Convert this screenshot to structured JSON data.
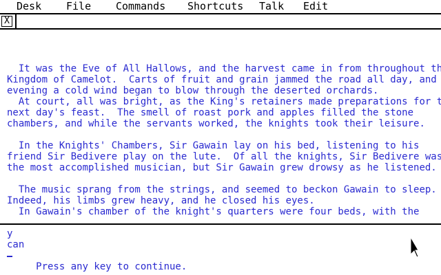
{
  "menubar": {
    "items": [
      "Desk",
      "File",
      "Commands",
      "Shortcuts",
      "Talk",
      "Edit"
    ]
  },
  "window": {
    "close_glyph": "X"
  },
  "story": {
    "lines": [
      "  It was the Eve of All Hallows, and the harvest came in from throughout the",
      "Kingdom of Camelot.  Carts of fruit and grain jammed the road all day, and by",
      "evening a cold wind began to blow through the deserted orchards.",
      "  At court, all was bright, as the King's retainers made preparations for the",
      "next day's feast.  The smell of roast pork and apples filled the stone",
      "chambers, and while the servants worked, the knights took their leisure.",
      "",
      "  In the Knights' Chambers, Sir Gawain lay on his bed, listening to his",
      "friend Sir Bedivere play on the lute.  Of all the knights, Sir Bedivere was",
      "the most accomplished musician, but Sir Gawain grew drowsy as he listened.",
      "",
      "  The music sprang from the strings, and seemed to beckon Gawain to sleep.",
      "Indeed, his limbs grew heavy, and he closed his eyes.",
      "  In Gawain's chamber of the knight's quarters were four beds, with the"
    ]
  },
  "input": {
    "line1": "y",
    "line2": "can",
    "prompt": "     Press any key to continue."
  },
  "colors": {
    "text": "#2a2ad0",
    "background": "#ffffff",
    "frame": "#000000"
  }
}
